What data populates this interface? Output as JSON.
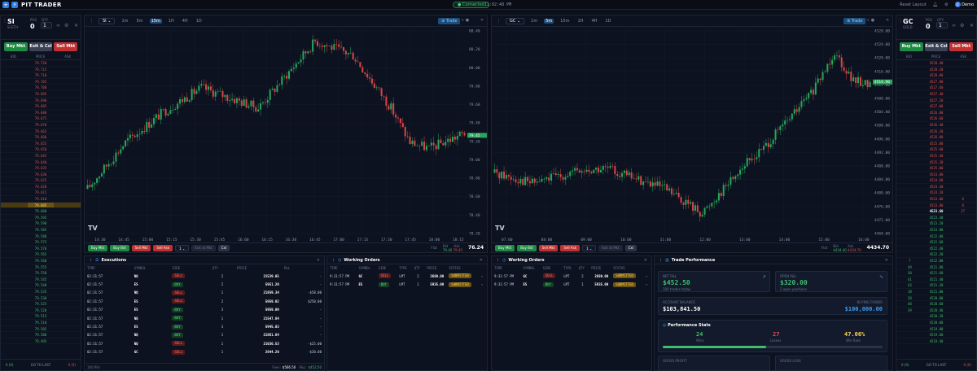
{
  "topbar": {
    "brand": "PIT TRADER",
    "connection": "Connected",
    "time": "11:02:48 PM",
    "reset": "Reset Layout",
    "user": "Demo",
    "avatar": "D"
  },
  "dom_left": {
    "symbol": "SI",
    "sub": "SI.ETH",
    "pos_label": "POS",
    "pos": "0",
    "qty_label": "QTY",
    "qty": "1",
    "buy": "Buy Mkt",
    "exit": "Exit & Cxl",
    "sell": "Sell Mkt",
    "col_bid": "BID",
    "col_price": "PRICE",
    "col_ask": "ASK",
    "footer_left": "0 (0)",
    "footer_mid": "GO TO LAST",
    "footer_right": "0 (0)",
    "ladder": [
      "79.720",
      "79.715",
      "79.710",
      "79.705",
      "79.700",
      "79.695",
      "79.690",
      "79.685",
      "79.680",
      "79.675",
      "79.670",
      "79.665",
      "79.660",
      "79.655",
      "79.650",
      "79.645",
      "79.640",
      "79.635",
      "79.630",
      "79.625",
      "79.620",
      "79.615",
      "79.610",
      "79.605",
      "79.600",
      "79.595",
      "79.590",
      "79.585",
      "79.580",
      "79.575",
      "79.570",
      "79.565",
      "79.560",
      "79.555",
      "79.550",
      "79.545",
      "79.540",
      "79.535",
      "79.530",
      "79.525",
      "79.520",
      "79.515",
      "79.510",
      "79.505",
      "79.500",
      "79.495"
    ],
    "mid_index": 23
  },
  "dom_right": {
    "symbol": "GC",
    "sub": "GOLD",
    "pos_label": "POS",
    "pos": "0",
    "qty_label": "QTY",
    "qty": "1",
    "buy": "Buy Mkt",
    "exit": "Exit & Cxl",
    "sell": "Sell Mkt",
    "col_bid": "BID",
    "col_price": "PRICE",
    "col_ask": "ASK",
    "footer_left": "0 (0)",
    "footer_mid": "GO TO LAST",
    "footer_right": "0 (0)",
    "ladder": [
      "4528.40",
      "4528.20",
      "4528.00",
      "4527.80",
      "4527.60",
      "4527.40",
      "4527.20",
      "4527.00",
      "4526.80",
      "4526.60",
      "4526.40",
      "4526.20",
      "4526.00",
      "4525.80",
      "4525.60",
      "4525.40",
      "4525.20",
      "4525.00",
      "4524.80",
      "4524.60",
      "4524.40",
      "4524.20",
      "4524.00",
      "4523.80",
      "4523.60",
      "4523.40",
      "4523.20",
      "4523.00",
      "4522.80",
      "4522.60",
      "4522.40",
      "4522.20",
      "4522.00",
      "4521.80",
      "4521.60",
      "4521.40",
      "4521.20",
      "4521.00",
      "4520.80",
      "4520.60",
      "4520.40",
      "4520.20",
      "4520.00",
      "4519.80",
      "4519.60",
      "4519.40"
    ],
    "asks": [
      "",
      "",
      "",
      "",
      "",
      "",
      "",
      "",
      "",
      "",
      "",
      "",
      "",
      "",
      "",
      "",
      "",
      "",
      "",
      "",
      "",
      "",
      "6",
      "8",
      "27",
      "",
      "",
      "",
      "",
      "",
      "",
      "",
      "",
      "",
      "",
      "",
      "",
      "",
      "",
      "",
      "",
      "",
      "",
      "",
      "",
      ""
    ],
    "bids": [
      "",
      "",
      "",
      "",
      "",
      "",
      "",
      "",
      "",
      "",
      "",
      "",
      "",
      "",
      "",
      "",
      "",
      "",
      "",
      "",
      "",
      "",
      "",
      "",
      "",
      "",
      "",
      "",
      "",
      "",
      "",
      "",
      "7",
      "49",
      "30",
      "41",
      "43",
      "18",
      "38",
      "40",
      "39",
      "",
      "",
      "",
      "",
      ""
    ],
    "mid_index": 24
  },
  "chart_si": {
    "symbol": "SI",
    "tfs": [
      "1m",
      "5m",
      "15m",
      "1H",
      "4H",
      "1D"
    ],
    "active_tf": "15m",
    "trade": "Trade",
    "last": "79.45",
    "y_ticks": [
      "80.40",
      "80.20",
      "80.00",
      "79.80",
      "79.60",
      "79.40",
      "79.20",
      "79.00",
      "78.80",
      "78.60",
      "78.40",
      "78.20"
    ],
    "x_ticks": [
      "14:30",
      "14:45",
      "15:00",
      "15:15",
      "15:30",
      "15:45",
      "16:00",
      "16:15",
      "16:30",
      "16:45",
      "17:00",
      "17:15",
      "17:30",
      "17:45",
      "18:00",
      "18:15"
    ],
    "buy_mkt": "Buy Mkt",
    "buy_bid": "Buy Bid",
    "sell_mkt": "Sell Mkt",
    "sell_ask": "Sell Ask",
    "qty": "1",
    "exit": "Exit at Mkt",
    "cxl": "Cxl",
    "flat": "Flat",
    "bid_lbl": "Bid",
    "ask_lbl": "Ask",
    "bid": "79.40",
    "ask": "79.45",
    "price": "76.24"
  },
  "chart_gc": {
    "symbol": "GC",
    "tfs": [
      "1m",
      "5m",
      "15m",
      "1H",
      "4H",
      "1D"
    ],
    "active_tf": "5m",
    "trade": "Trade",
    "last": "4514.90",
    "y_ticks": [
      "4528.00",
      "4524.00",
      "4520.00",
      "4516.00",
      "4512.00",
      "4508.00",
      "4504.00",
      "4500.00",
      "4496.00",
      "4492.00",
      "4488.00",
      "4484.00",
      "4480.00",
      "4476.00",
      "4472.00",
      "4468.00"
    ],
    "x_ticks": [
      "07:00",
      "08:00",
      "09:00",
      "10:00",
      "11:00",
      "12:00",
      "13:00",
      "14:00",
      "15:00",
      "16:00"
    ],
    "buy_mkt": "Buy Mkt",
    "buy_bid": "Buy Bid",
    "sell_mkt": "Sell Mkt",
    "sell_ask": "Sell Ask",
    "qty": "1",
    "exit": "Exit at Mkt",
    "cxl": "Cxl",
    "flat": "Flat",
    "bid_lbl": "Bid",
    "ask_lbl": "Ask",
    "bid": "4434.40",
    "ask": "4434.70",
    "price": "4434.70"
  },
  "executions": {
    "title": "Executions",
    "cols": [
      "TIME",
      "SYMBOL",
      "SIDE",
      "QTY",
      "PRICE",
      "P&L"
    ],
    "rows": [
      [
        "02:31:57",
        "NQ",
        "SELL",
        "2",
        "21539.05",
        "-"
      ],
      [
        "02:31:57",
        "ES",
        "BUY",
        "2",
        "5951.20",
        "-"
      ],
      [
        "02:31:57",
        "NQ",
        "SELL",
        "1",
        "21859.34",
        "-$58.00"
      ],
      [
        "02:31:57",
        "ES",
        "SELL",
        "2",
        "5959.02",
        "$250.00"
      ],
      [
        "02:31:57",
        "ES",
        "BUY",
        "3",
        "5959.09",
        "-"
      ],
      [
        "02:31:57",
        "NQ",
        "BUY",
        "1",
        "21547.84",
        "-"
      ],
      [
        "02:31:57",
        "ES",
        "BUY",
        "3",
        "5945.03",
        "-"
      ],
      [
        "02:31:57",
        "NQ",
        "BUY",
        "1",
        "21861.84",
        "-"
      ],
      [
        "02:31:57",
        "NQ",
        "SELL",
        "1",
        "21036.53",
        "-$25.00"
      ],
      [
        "02:31:57",
        "GC",
        "SELL",
        "1",
        "2644.20",
        "-$20.00"
      ]
    ],
    "fills": "100 fills",
    "fees_lbl": "Fees:",
    "fees": "$566.50",
    "pl_lbl": "P&L:",
    "pl": "$452.50"
  },
  "wo1": {
    "title": "Working Orders",
    "cols": [
      "TIME",
      "SYMBOL",
      "SIDE",
      "TYPE",
      "QTY",
      "PRICE",
      "STATUS"
    ],
    "rows": [
      [
        "9:31:57 PM",
        "GC",
        "SELL",
        "LMT",
        "2",
        "2680.00",
        "SUBMITTED"
      ],
      [
        "9:31:57 PM",
        "ES",
        "BUY",
        "LMT",
        "1",
        "5935.00",
        "SUBMITTED"
      ]
    ]
  },
  "wo2": {
    "title": "Working Orders",
    "cols": [
      "TIME",
      "SYMBOL",
      "SIDE",
      "TYPE",
      "QTY",
      "PRICE",
      "STATUS"
    ],
    "rows": [
      [
        "9:31:57 PM",
        "GC",
        "SELL",
        "LMT",
        "2",
        "2680.00",
        "SUBMITTED"
      ],
      [
        "9:31:57 PM",
        "ES",
        "BUY",
        "LMT",
        "1",
        "5935.00",
        "SUBMITTED"
      ]
    ]
  },
  "perf": {
    "title": "Trade Performance",
    "net_lbl": "NET P&L",
    "net": "$452.50",
    "net_sub": "100 trades today",
    "open_lbl": "OPEN P&L",
    "open": "$320.00",
    "open_sub": "2 open positions",
    "bal_lbl": "ACCOUNT BALANCE",
    "bal": "$103,841.50",
    "bp_lbl": "BUYING POWER",
    "bp": "$100,000.00",
    "stats_title": "Performance Stats",
    "wins": "24",
    "wins_lbl": "Wins",
    "losses": "27",
    "losses_lbl": "Losses",
    "rate": "47.06%",
    "rate_lbl": "Win Rate",
    "win_fraction": 0.47,
    "gp_lbl": "GROSS PROFIT",
    "gl_lbl": "GROSS LOSS"
  }
}
